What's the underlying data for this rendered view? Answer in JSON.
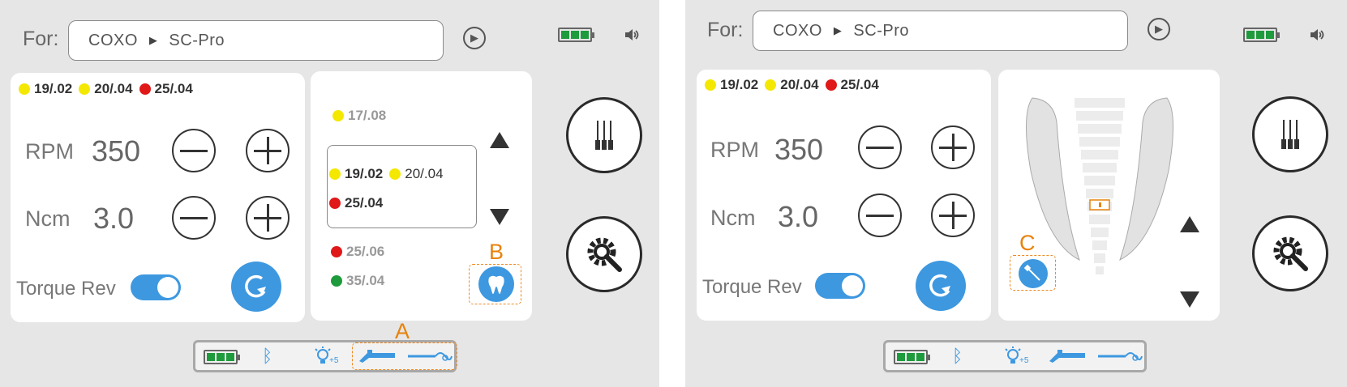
{
  "left": {
    "for_label": "For:",
    "brand": "COXO",
    "model": "SC-Pro",
    "legend": [
      {
        "label": "19/.02",
        "color": "yellow"
      },
      {
        "label": "20/.04",
        "color": "yellow"
      },
      {
        "label": "25/.04",
        "color": "red"
      }
    ],
    "rpm_label": "RPM",
    "rpm_value": "350",
    "ncm_label": "Ncm",
    "ncm_value": "3.0",
    "torque_rev_label": "Torque Rev",
    "torque_rev_on": true,
    "file_list": {
      "above": [
        {
          "label": "17/.08",
          "color": "yellow"
        }
      ],
      "selected_row1": [
        {
          "label": "19/.02",
          "color": "yellow"
        },
        {
          "label": "20/.04",
          "color": "yellow"
        }
      ],
      "selected_row2": [
        {
          "label": "25/.04",
          "color": "red"
        }
      ],
      "below": [
        {
          "label": "25/.06",
          "color": "red"
        },
        {
          "label": "35/.04",
          "color": "green"
        }
      ]
    },
    "callouts": {
      "a": "A",
      "b": "B"
    },
    "status": {
      "bt_icon": "bluetooth-icon",
      "light_level": "+5"
    }
  },
  "right": {
    "for_label": "For:",
    "brand": "COXO",
    "model": "SC-Pro",
    "legend": [
      {
        "label": "19/.02",
        "color": "yellow"
      },
      {
        "label": "20/.04",
        "color": "yellow"
      },
      {
        "label": "25/.04",
        "color": "red"
      }
    ],
    "rpm_label": "RPM",
    "rpm_value": "350",
    "ncm_label": "Ncm",
    "ncm_value": "3.0",
    "torque_rev_label": "Torque Rev",
    "torque_rev_on": true,
    "callouts": {
      "c": "C"
    },
    "status": {
      "bt_icon": "bluetooth-icon",
      "light_level": "+5"
    }
  },
  "colors": {
    "accent": "#3d98e0",
    "callout": "#e8820a",
    "battery": "#1e9b3c",
    "yellow": "#f4e800",
    "red": "#e01818",
    "green": "#1e9b3c"
  }
}
